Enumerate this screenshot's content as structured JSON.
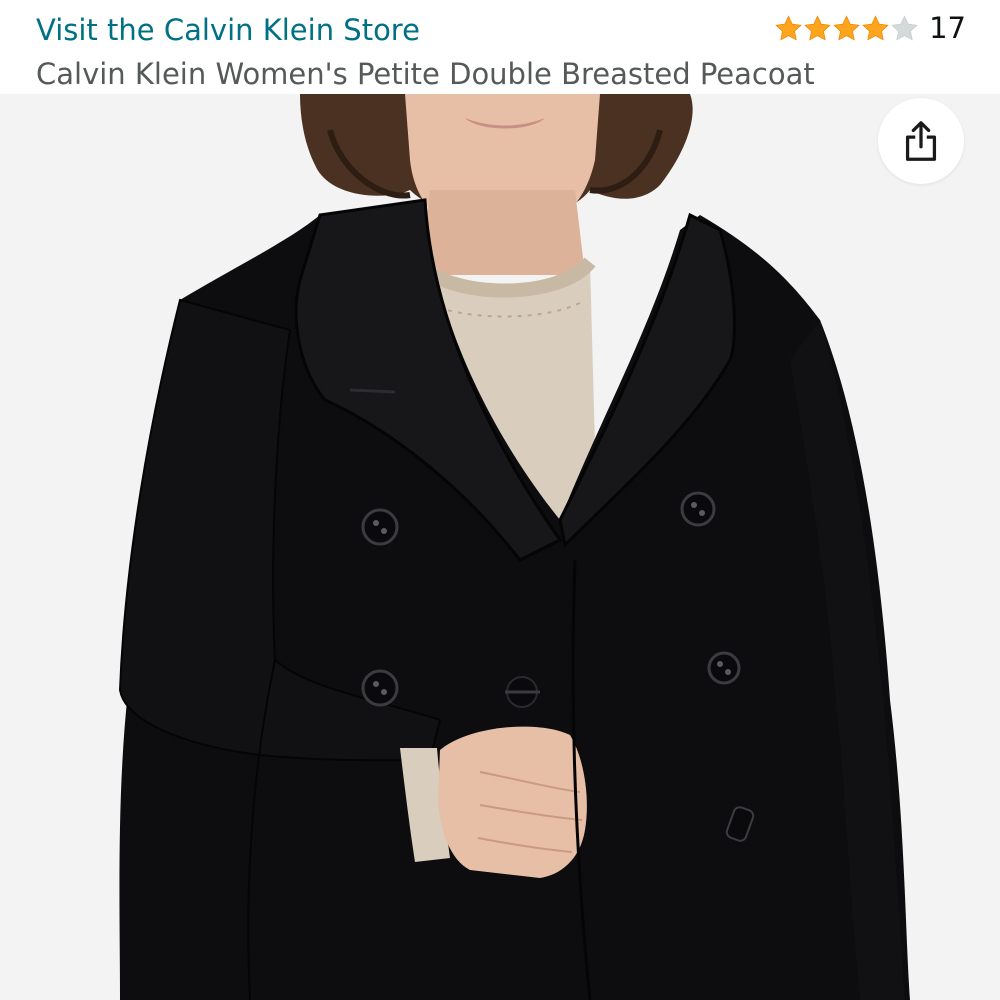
{
  "header": {
    "store_link": "Visit the Calvin Klein Store",
    "product_title": "Calvin Klein Women's Petite Double Breasted Peacoat",
    "rating": {
      "value": 4,
      "max": 5,
      "count": "17",
      "star_color": "#ffa41c",
      "empty_star_color": "#d5d9d9"
    }
  },
  "colors": {
    "link": "#007185",
    "title": "#565959",
    "image_background": "#f3f3f3",
    "coat": "#0d0d0f",
    "sweater": "#d9cdbd"
  },
  "image": {
    "icons": {
      "share": "share-icon"
    }
  }
}
